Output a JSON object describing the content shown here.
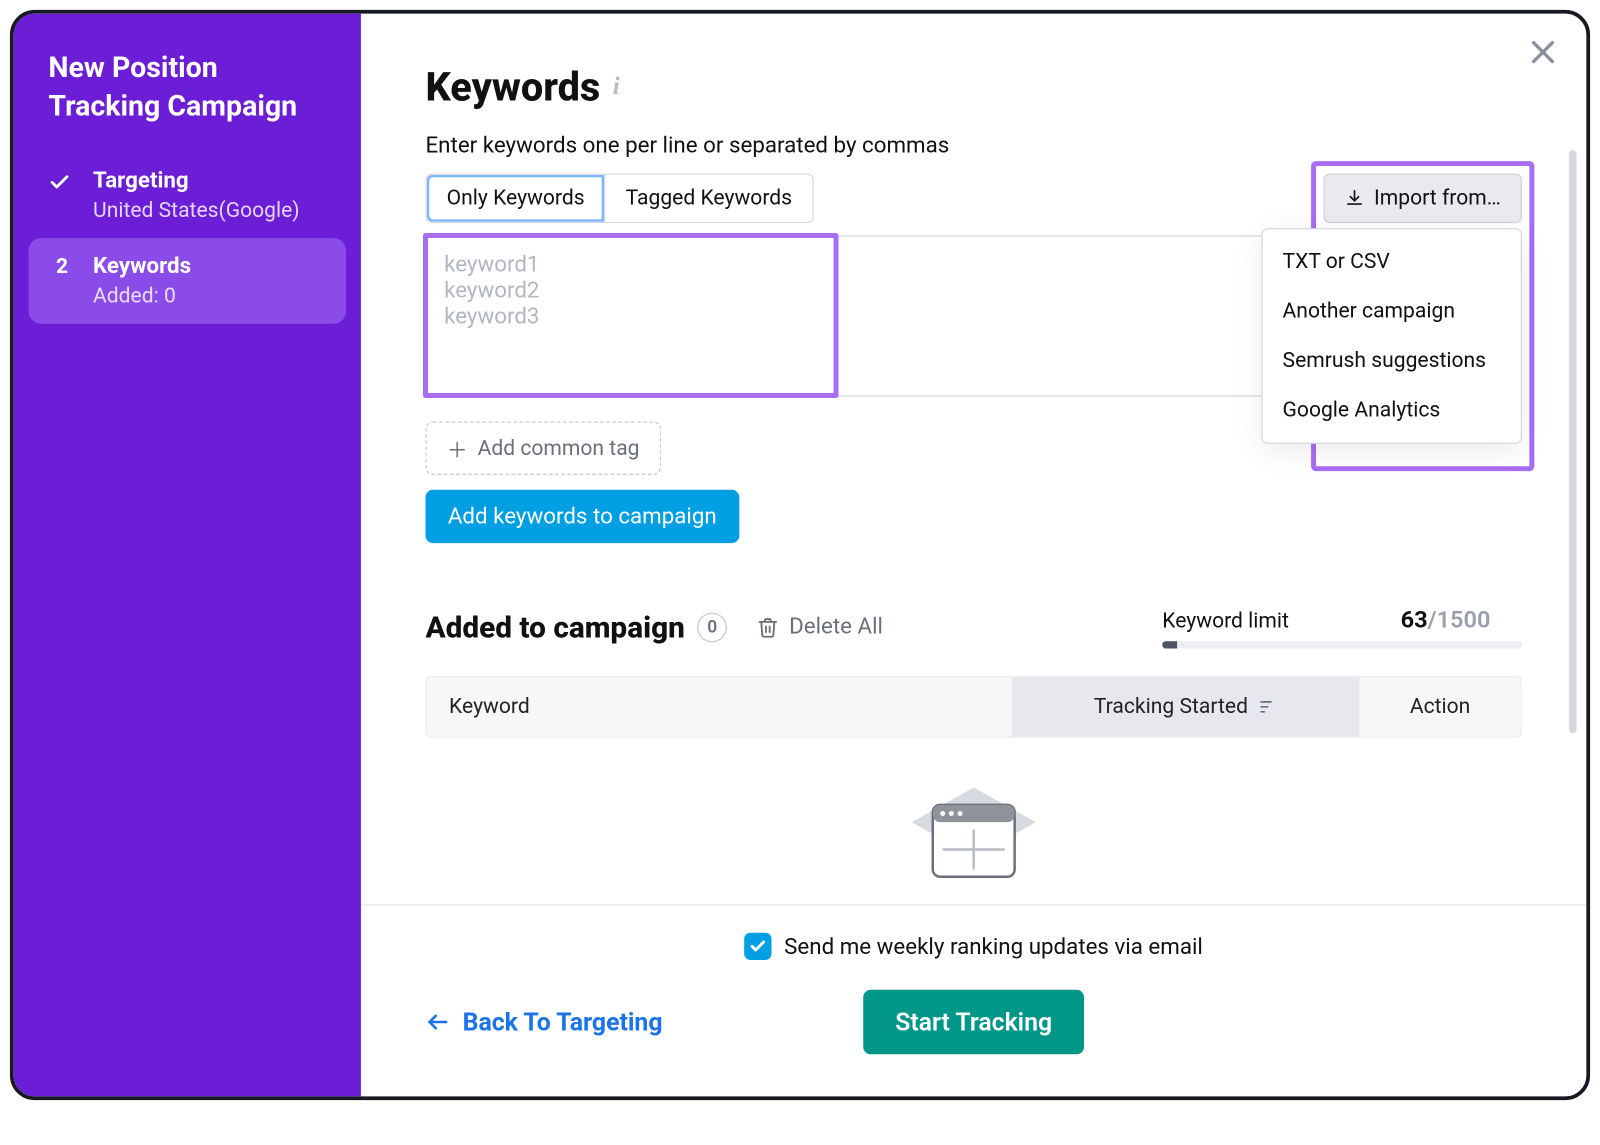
{
  "sidebar": {
    "title": "New Position Tracking Campaign",
    "steps": [
      {
        "name": "Targeting",
        "sub": "United States(Google)"
      },
      {
        "name": "Keywords",
        "sub": "Added: 0",
        "marker": "2"
      }
    ]
  },
  "main": {
    "heading": "Keywords",
    "hint": "Enter keywords one per line or separated by commas",
    "segments": {
      "only": "Only Keywords",
      "tagged": "Tagged Keywords"
    },
    "import_label": "Import from…",
    "import_menu": [
      "TXT or CSV",
      "Another campaign",
      "Semrush suggestions",
      "Google Analytics"
    ],
    "textarea_placeholder": "keyword1\nkeyword2\nkeyword3",
    "add_tag": "Add common tag",
    "add_kw": "Add keywords to campaign",
    "section2": {
      "title": "Added to campaign",
      "count": "0",
      "delete_all": "Delete All",
      "limit_label": "Keyword limit",
      "limit_used": "63",
      "limit_max": "/1500",
      "cols": {
        "c1": "Keyword",
        "c2": "Tracking Started",
        "c3": "Action"
      }
    }
  },
  "footer": {
    "checkbox_label": "Send me weekly ranking updates via email",
    "back": "Back To Targeting",
    "start": "Start Tracking"
  }
}
